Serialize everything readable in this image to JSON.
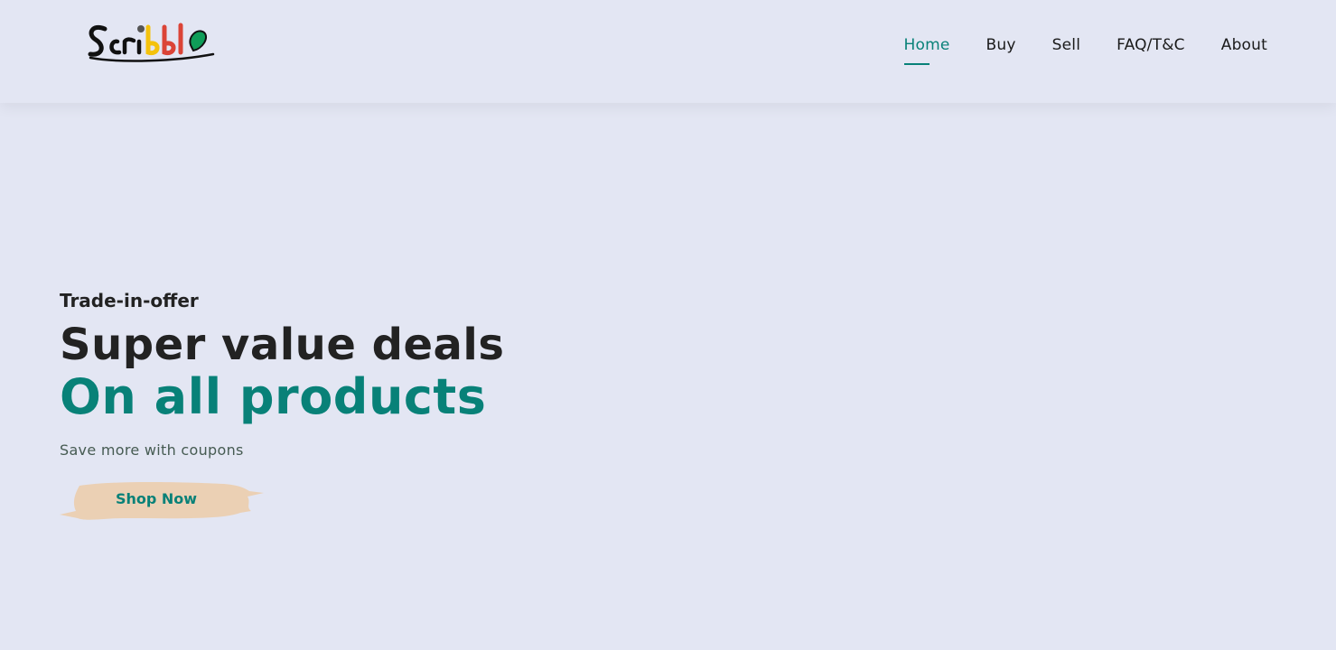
{
  "brand": {
    "logo_text": "Scribble",
    "logo_colors": [
      "#111111",
      "#111111",
      "#111111",
      "#111111",
      "#f4c20d",
      "#db4437",
      "#db4437",
      "#0f9d58"
    ]
  },
  "nav": {
    "items": [
      {
        "label": "Home",
        "active": true
      },
      {
        "label": "Buy",
        "active": false
      },
      {
        "label": "Sell",
        "active": false
      },
      {
        "label": "FAQ/T&C",
        "active": false
      },
      {
        "label": "About",
        "active": false
      }
    ]
  },
  "hero": {
    "kicker": "Trade-in-offer",
    "title": "Super value deals",
    "highlight": "On all products",
    "subtitle": "Save more with coupons",
    "cta_label": "Shop Now"
  },
  "colors": {
    "accent": "#088178",
    "background": "#e3e6f3",
    "button_brush": "#ebd0b4"
  }
}
